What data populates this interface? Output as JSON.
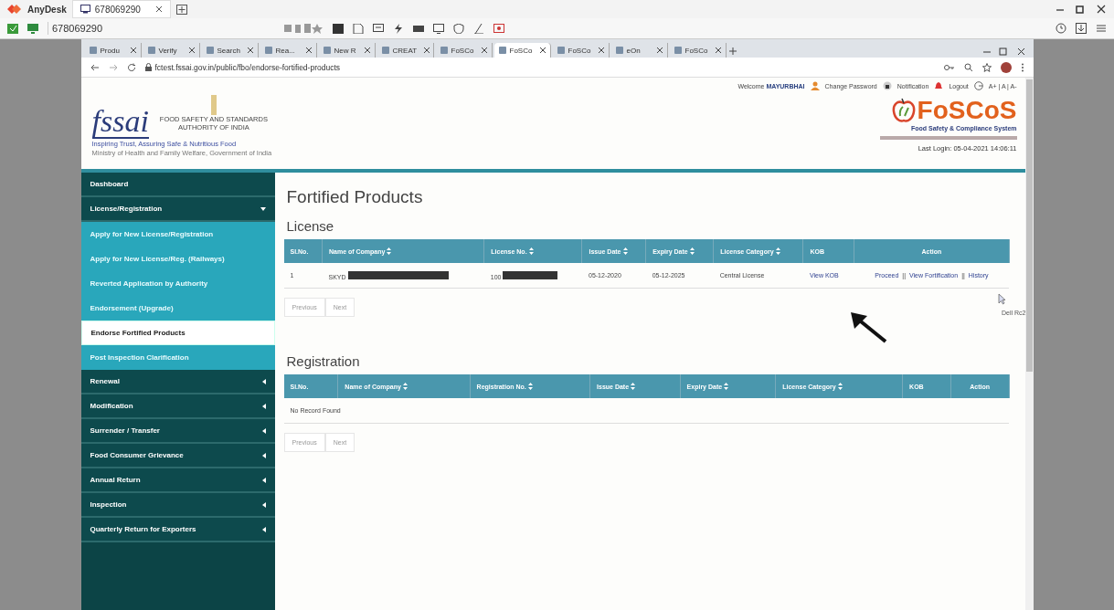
{
  "anydesk": {
    "app_name": "AnyDesk",
    "session_tab": "678069290",
    "address": "678069290"
  },
  "browser": {
    "tabs": [
      {
        "label": "Produ",
        "selected": false
      },
      {
        "label": "Verify",
        "selected": false
      },
      {
        "label": "Search",
        "selected": false
      },
      {
        "label": "Rea...",
        "selected": false
      },
      {
        "label": "New R",
        "selected": false
      },
      {
        "label": "CREAT",
        "selected": false
      },
      {
        "label": "FoSCo",
        "selected": false
      },
      {
        "label": "FoSCo",
        "selected": true
      },
      {
        "label": "FoSCo",
        "selected": false
      },
      {
        "label": "eOn",
        "selected": false
      },
      {
        "label": "FoSCo",
        "selected": false
      }
    ],
    "url": "fctest.fssai.gov.in/public/fbo/endorse-fortified-products"
  },
  "header": {
    "welcome": "Welcome",
    "user": "MAYURBHAI",
    "links": [
      "Change Password",
      "Notification",
      "Logout"
    ],
    "font_size": "A+ | A | A-",
    "fssai_logo": "fssai",
    "authority": "FOOD SAFETY AND STANDARDS AUTHORITY OF INDIA",
    "tagline": "Inspiring Trust, Assuring Safe & Nutritious Food",
    "ministry": "Ministry of Health and Family Welfare, Government of India",
    "foscos_logo": "FoSCoS",
    "foscos_subtitle": "Food Safety & Compliance System",
    "last_login": "Last Login: 05-04-2021 14:06:11"
  },
  "sidebar": {
    "items": [
      {
        "kind": "link",
        "label": "Dashboard"
      },
      {
        "kind": "group",
        "label": "License/Registration",
        "expanded": true,
        "children": [
          {
            "label": "Apply for New License/Registration",
            "selected": false
          },
          {
            "label": "Apply for New License/Reg. (Railways)",
            "selected": false
          },
          {
            "label": "Reverted Application by Authority",
            "selected": false
          },
          {
            "label": "Endorsement (Upgrade)",
            "selected": false
          },
          {
            "label": "Endorse Fortified Products",
            "selected": true
          },
          {
            "label": "Post Inspection Clarification",
            "selected": false
          }
        ]
      },
      {
        "kind": "group",
        "label": "Renewal",
        "expanded": false
      },
      {
        "kind": "group",
        "label": "Modification",
        "expanded": false
      },
      {
        "kind": "group",
        "label": "Surrender / Transfer",
        "expanded": false
      },
      {
        "kind": "group",
        "label": "Food Consumer Grievance",
        "expanded": false
      },
      {
        "kind": "group",
        "label": "Annual Return",
        "expanded": false
      },
      {
        "kind": "group",
        "label": "Inspection",
        "expanded": false
      },
      {
        "kind": "group",
        "label": "Quarterly Return for Exporters",
        "expanded": false
      }
    ]
  },
  "main": {
    "title": "Fortified Products",
    "sections": [
      {
        "heading": "License",
        "columns": [
          {
            "label": "Sl.No.",
            "sortable": false
          },
          {
            "label": "Name of Company",
            "sortable": true
          },
          {
            "label": "License No.",
            "sortable": true
          },
          {
            "label": "Issue Date",
            "sortable": true
          },
          {
            "label": "Expiry Date",
            "sortable": true
          },
          {
            "label": "License Category",
            "sortable": true
          },
          {
            "label": "KOB",
            "sortable": false
          },
          {
            "label": "Action",
            "sortable": false
          }
        ],
        "rows": [
          {
            "sl": "1",
            "company": {
              "text": "SKYD",
              "redacted": true
            },
            "license_no": {
              "text": "100",
              "redacted": true
            },
            "issue_date": "05-12-2020",
            "expiry_date": "05-12-2025",
            "category": "Central License",
            "kob": "View KOB",
            "actions": [
              "Proceed",
              "View Fortification",
              "History"
            ],
            "separator": "||"
          }
        ],
        "pager": [
          "Previous",
          "Next"
        ]
      },
      {
        "heading": "Registration",
        "columns": [
          {
            "label": "Sl.No.",
            "sortable": false
          },
          {
            "label": "Name of Company",
            "sortable": true
          },
          {
            "label": "Registration No.",
            "sortable": true
          },
          {
            "label": "Issue Date",
            "sortable": true
          },
          {
            "label": "Expiry Date",
            "sortable": true
          },
          {
            "label": "License Category",
            "sortable": true
          },
          {
            "label": "KOB",
            "sortable": false
          },
          {
            "label": "Action",
            "sortable": false
          }
        ],
        "empty_text": "No Record Found",
        "pager": [
          "Previous",
          "Next"
        ]
      }
    ],
    "cursor_tooltip": "Dell Rc2"
  }
}
